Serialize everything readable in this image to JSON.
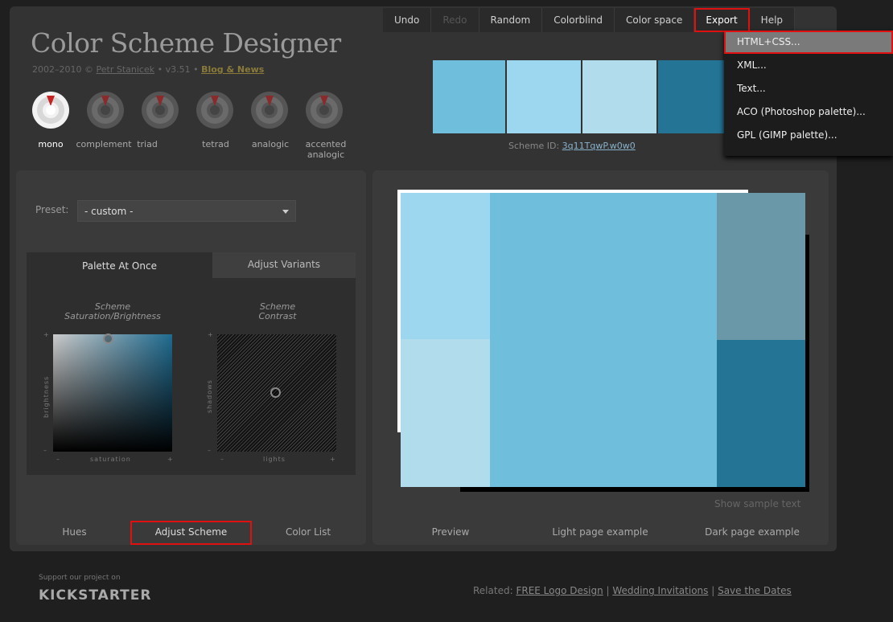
{
  "app": {
    "title": "Color Scheme Designer",
    "credits_prefix": "2002–2010 ©",
    "author": "Petr Stanicek",
    "version": "• v3.51 •",
    "blog": "Blog & News"
  },
  "nav": {
    "undo": "Undo",
    "redo": "Redo",
    "random": "Random",
    "colorblind": "Colorblind",
    "colorspace": "Color space",
    "export": "Export",
    "help": "Help"
  },
  "export_menu": [
    "HTML+CSS...",
    "XML...",
    "Text...",
    "ACO (Photoshop palette)...",
    "GPL (GIMP palette)..."
  ],
  "schemes": [
    "mono",
    "complement",
    "triad",
    "tetrad",
    "analogic",
    "accented analogic"
  ],
  "palette": {
    "colors": [
      "#6FBEDB",
      "#9CD7EF",
      "#B1DCEC",
      "#247496"
    ],
    "scheme_id_label": "Scheme ID:",
    "scheme_id": "3q11TqwP.w0w0"
  },
  "left": {
    "preset_label": "Preset:",
    "preset_value": "- custom -",
    "tab_palette": "Palette At Once",
    "tab_variants": "Adjust Variants",
    "sat_title_1": "Scheme",
    "sat_title_2": "Saturation/Brightness",
    "con_title_1": "Scheme",
    "con_title_2": "Contrast",
    "axis_brightness": "brightness",
    "axis_saturation": "saturation",
    "axis_shadows": "shadows",
    "axis_lights": "lights",
    "minus": "–",
    "plus": "+",
    "bottom_tabs": [
      "Hues",
      "Adjust Scheme",
      "Color List"
    ]
  },
  "right": {
    "show_sample": "Show sample text",
    "bottom_tabs": [
      "Preview",
      "Light page example",
      "Dark page example"
    ]
  },
  "footer": {
    "kick_1": "Support our project on",
    "kick_2": "KICKSTARTER",
    "related_prefix": "Related:",
    "related_links": [
      "FREE Logo Design",
      "Wedding Invitations",
      "Save the Dates"
    ]
  }
}
